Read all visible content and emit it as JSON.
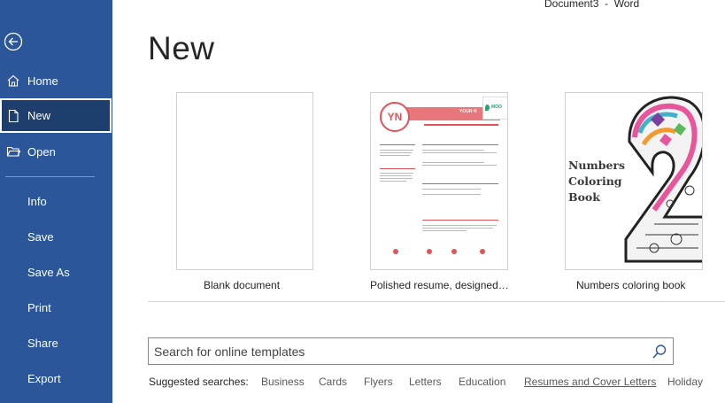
{
  "window": {
    "title": "Document3  -  Word"
  },
  "sidebar": {
    "back_label": "Back",
    "items": [
      {
        "label": "Home",
        "icon": "home-icon"
      },
      {
        "label": "New",
        "icon": "new-document-icon",
        "active": true
      },
      {
        "label": "Open",
        "icon": "folder-icon"
      },
      {
        "label": "Info"
      },
      {
        "label": "Save"
      },
      {
        "label": "Save As"
      },
      {
        "label": "Print"
      },
      {
        "label": "Share"
      },
      {
        "label": "Export"
      }
    ]
  },
  "main": {
    "title": "New",
    "templates": [
      {
        "label": "Blank document"
      },
      {
        "label": "Polished resume, designed…",
        "initials": "YN",
        "badge": "MOO",
        "name_fragment": "YOUR N"
      },
      {
        "label": "Numbers coloring book",
        "cover_text": "Numbers Coloring Book"
      }
    ],
    "search": {
      "placeholder": "Search for online templates"
    },
    "suggested": {
      "label": "Suggested searches:",
      "items": [
        "Business",
        "Cards",
        "Flyers",
        "Letters",
        "Education",
        "Resumes and Cover Letters",
        "Holiday"
      ]
    }
  },
  "colors": {
    "sidebar": "#2b579a",
    "active_item": "#1e3e6e",
    "resume_accent": "#e0535a"
  }
}
